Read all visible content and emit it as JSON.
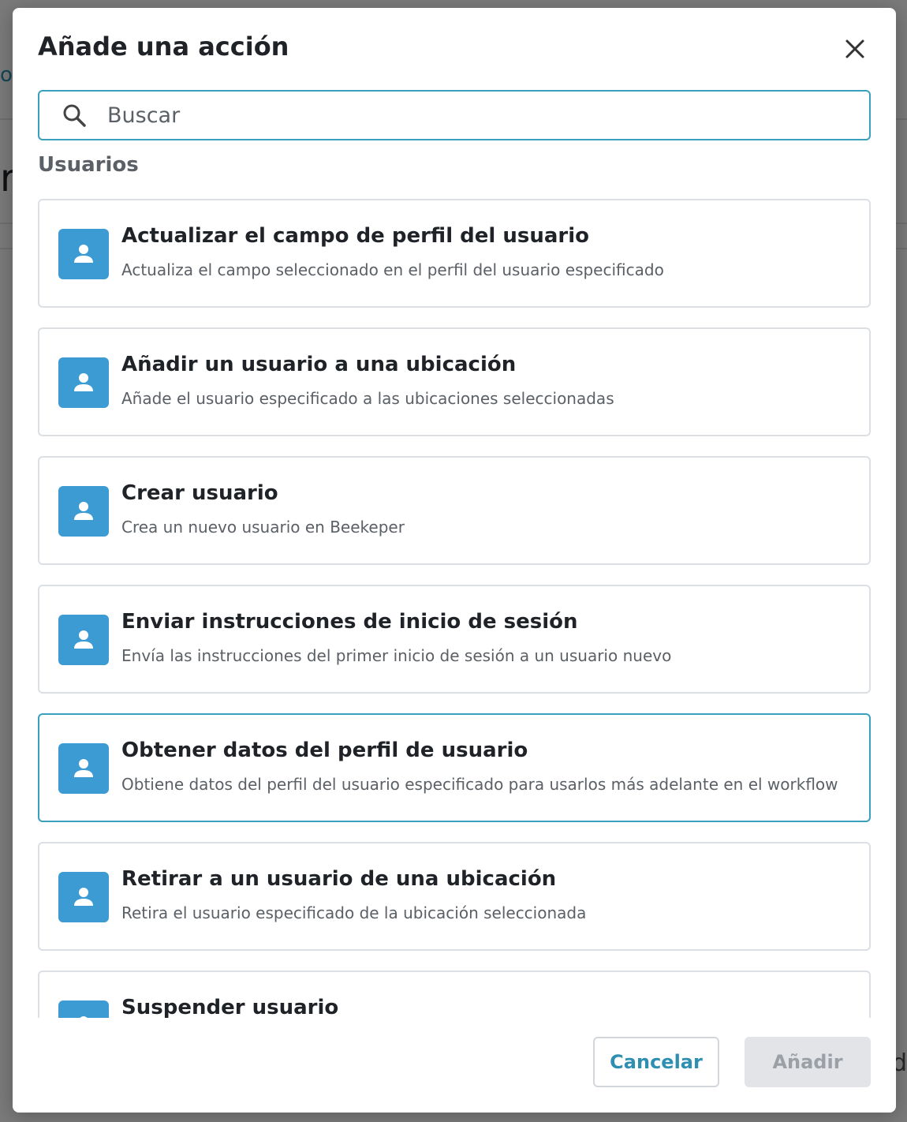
{
  "background": {
    "fragment_top": "or",
    "fragment_mid": "r",
    "fragment_bottom": "d"
  },
  "modal": {
    "title": "Añade una acción",
    "close_icon": "close-icon",
    "search": {
      "placeholder": "Buscar",
      "value": "",
      "icon": "search-icon"
    },
    "section_label": "Usuarios",
    "actions": [
      {
        "title": "Actualizar el campo de perfil del usuario",
        "description": "Actualiza el campo seleccionado en el perfil del usuario especificado",
        "icon": "user-icon"
      },
      {
        "title": "Añadir un usuario a una ubicación",
        "description": "Añade el usuario especificado a las ubicaciones seleccionadas",
        "icon": "user-icon"
      },
      {
        "title": "Crear usuario",
        "description": "Crea un nuevo usuario en Beekeper",
        "icon": "user-icon"
      },
      {
        "title": "Enviar instrucciones de inicio de sesión",
        "description": "Envía las instrucciones del primer inicio de sesión a un usuario nuevo",
        "icon": "user-icon"
      },
      {
        "title": "Obtener datos del perfil de usuario",
        "description": "Obtiene datos del perfil del usuario especificado para usarlos más adelante en el workflow",
        "icon": "user-icon"
      },
      {
        "title": "Retirar a un usuario de una ubicación",
        "description": "Retira el usuario especificado de la ubicación seleccionada",
        "icon": "user-icon"
      },
      {
        "title": "Suspender usuario",
        "description": "",
        "icon": "user-icon"
      }
    ],
    "highlighted_action": 4,
    "buttons": {
      "cancel_label": "Cancelar",
      "add_label": "Añadir"
    }
  },
  "colors": {
    "accent": "#3aa0bd",
    "link": "#2f8fb0",
    "icon_bg": "#3d9bd4",
    "disabled_bg": "#e2e4e7"
  }
}
